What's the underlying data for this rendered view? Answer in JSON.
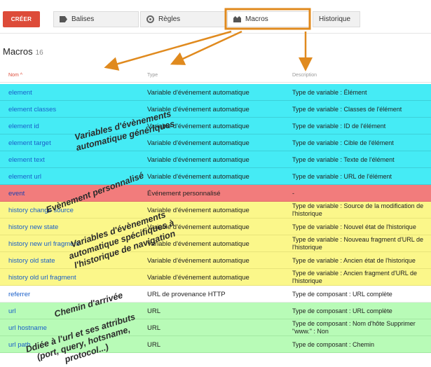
{
  "toolbar": {
    "create_label": "CRÉER",
    "tabs": [
      {
        "label": "Balises",
        "icon": "tag-icon"
      },
      {
        "label": "Règles",
        "icon": "rules-icon"
      },
      {
        "label": "Macros",
        "icon": "macro-icon"
      },
      {
        "label": "Historique",
        "icon": ""
      }
    ]
  },
  "main": {
    "title": "Macros",
    "count": "16"
  },
  "table": {
    "headers": {
      "name": "Nom",
      "type": "Type",
      "description": "Description"
    },
    "sort_indicator": "^",
    "rows": [
      {
        "name": "element",
        "type": "Variable d'événement automatique",
        "description": "Type de variable : Élément",
        "color": "cyan"
      },
      {
        "name": "element classes",
        "type": "Variable d'événement automatique",
        "description": "Type de variable : Classes de l'élément",
        "color": "cyan"
      },
      {
        "name": "element id",
        "type": "Variable d'événement automatique",
        "description": "Type de variable : ID de l'élément",
        "color": "cyan"
      },
      {
        "name": "element target",
        "type": "Variable d'événement automatique",
        "description": "Type de variable : Cible de l'élément",
        "color": "cyan"
      },
      {
        "name": "element text",
        "type": "Variable d'événement automatique",
        "description": "Type de variable : Texte de l'élément",
        "color": "cyan"
      },
      {
        "name": "element url",
        "type": "Variable d'événement automatique",
        "description": "Type de variable : URL de l'élément",
        "color": "cyan"
      },
      {
        "name": "event",
        "type": "Événement personnalisé",
        "description": "-",
        "color": "red"
      },
      {
        "name": "history change source",
        "type": "Variable d'événement automatique",
        "description": "Type de variable : Source de la modification de l'historique",
        "color": "yellow"
      },
      {
        "name": "history new state",
        "type": "Variable d'événement automatique",
        "description": "Type de variable : Nouvel état de l'historique",
        "color": "yellow"
      },
      {
        "name": "history new url fragment",
        "type": "Variable d'événement automatique",
        "description": "Type de variable : Nouveau fragment d'URL de l'historique",
        "color": "yellow"
      },
      {
        "name": "history old state",
        "type": "Variable d'événement automatique",
        "description": "Type de variable : Ancien état de l'historique",
        "color": "yellow"
      },
      {
        "name": "history old url fragment",
        "type": "Variable d'événement automatique",
        "description": "Type de variable : Ancien fragment d'URL de l'historique",
        "color": "yellow"
      },
      {
        "name": "referrer",
        "type": "URL de provenance HTTP",
        "description": "Type de composant : URL complète",
        "color": "white"
      },
      {
        "name": "url",
        "type": "URL",
        "description": "Type de composant : URL complète",
        "color": "green"
      },
      {
        "name": "url hostname",
        "type": "URL",
        "description": "Type de composant : Nom d'hôte Supprimer \"www.\" : Non",
        "color": "green"
      },
      {
        "name": "url path",
        "type": "URL",
        "description": "Type de composant : Chemin",
        "color": "green"
      }
    ]
  },
  "annotations": {
    "auto_generic": [
      "Variables d'évènements",
      "automatique génériques"
    ],
    "custom_event": "Evènement personnalisé",
    "history": [
      "Variables d'évènements",
      "automatique spécifiques à",
      "l'historique de navigation"
    ],
    "referrer": "Chemin d'arrivée",
    "url": [
      "Ddiée à l'url et ses attributs",
      "(port, query, hotsname,",
      "protocol...)"
    ]
  },
  "colors": {
    "cyan": "#45ebf5",
    "red": "#f27c7c",
    "yellow": "#fbf78a",
    "green": "#b8fbb7",
    "highlight_box": "#e08a1e",
    "create_button": "#dd4b39"
  }
}
